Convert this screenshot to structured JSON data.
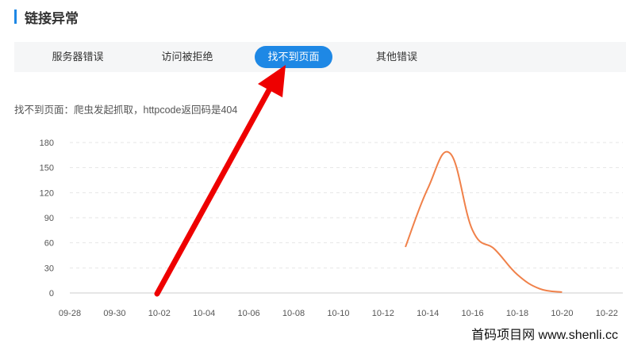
{
  "section": {
    "title": "链接异常",
    "accent": "#1e88e5"
  },
  "tabs": [
    {
      "label": "服务器错误",
      "active": false
    },
    {
      "label": "访问被拒绝",
      "active": false
    },
    {
      "label": "找不到页面",
      "active": true
    },
    {
      "label": "其他错误",
      "active": false
    }
  ],
  "description": "找不到页面：爬虫发起抓取，httpcode返回码是404",
  "watermark": "首码项目网  www.shenli.cc",
  "chart_data": {
    "type": "line",
    "title": "",
    "xlabel": "",
    "ylabel": "",
    "x_ticks": [
      "09-28",
      "09-30",
      "10-02",
      "10-04",
      "10-06",
      "10-08",
      "10-10",
      "10-12",
      "10-14",
      "10-16",
      "10-18",
      "10-20",
      "10-22"
    ],
    "y_ticks": [
      0,
      30,
      60,
      90,
      120,
      150,
      180
    ],
    "ylim": [
      0,
      180
    ],
    "xlim": [
      "09-28",
      "10-22"
    ],
    "grid": true,
    "line_color": "#f0814a",
    "series": [
      {
        "x": [
          "10-13",
          "10-14",
          "10-15",
          "10-16",
          "10-17",
          "10-18",
          "10-19",
          "10-20"
        ],
        "values": [
          55,
          125,
          167,
          75,
          52,
          22,
          5,
          1
        ]
      }
    ]
  },
  "annotation": {
    "color": "#ee0000"
  }
}
